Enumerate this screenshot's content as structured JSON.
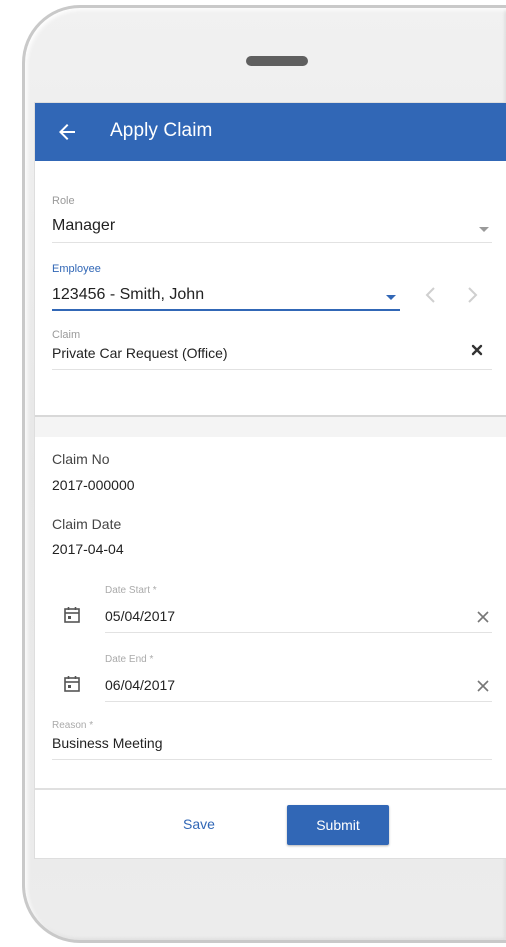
{
  "appbar": {
    "title": "Apply Claim",
    "back_icon": "arrow-left-icon"
  },
  "form": {
    "role": {
      "label": "Role",
      "value": "Manager"
    },
    "employee": {
      "label": "Employee",
      "value": "123456 - Smith, John"
    },
    "claim": {
      "label": "Claim",
      "value": "Private Car Request (Office)"
    }
  },
  "details": {
    "claim_no": {
      "label": "Claim No",
      "value": "2017-000000"
    },
    "claim_date": {
      "label": "Claim Date",
      "value": "2017-04-04"
    },
    "date_start": {
      "label": "Date Start *",
      "value": "05/04/2017"
    },
    "date_end": {
      "label": "Date End *",
      "value": "06/04/2017"
    },
    "reason": {
      "label": "Reason *",
      "value": "Business Meeting"
    }
  },
  "footer": {
    "save_label": "Save",
    "submit_label": "Submit"
  },
  "colors": {
    "primary": "#3167b6",
    "background": "#ffffff",
    "frame": "#e7e7e7"
  }
}
